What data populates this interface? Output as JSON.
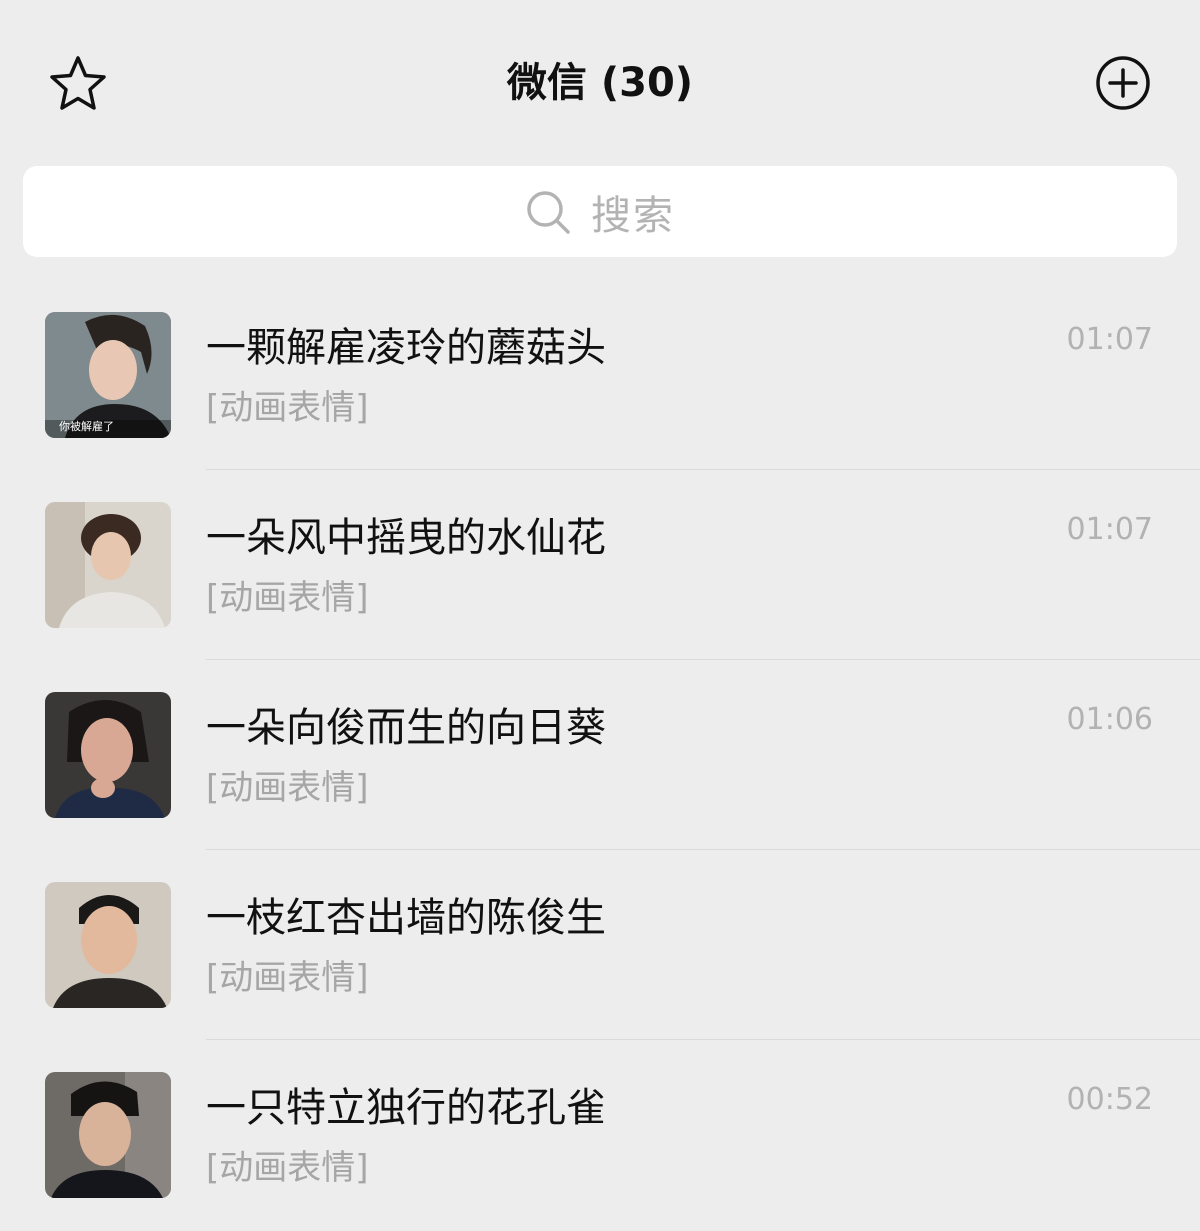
{
  "header": {
    "title": "微信 (30)",
    "left_icon": "star-icon",
    "right_icon": "add-circle-icon"
  },
  "search": {
    "icon": "search-icon",
    "placeholder": "搜索"
  },
  "chats": [
    {
      "name": "一颗解雇凌玲的蘑菇头",
      "preview": "[动画表情]",
      "time": "01:07",
      "avatar_caption": "你被解雇了"
    },
    {
      "name": "一朵风中摇曳的水仙花",
      "preview": "[动画表情]",
      "time": "01:07"
    },
    {
      "name": "一朵向俊而生的向日葵",
      "preview": "[动画表情]",
      "time": "01:06"
    },
    {
      "name": "一枝红杏出墙的陈俊生",
      "preview": "[动画表情]",
      "time": ""
    },
    {
      "name": "一只特立独行的花孔雀",
      "preview": "[动画表情]",
      "time": "00:52"
    }
  ],
  "colors": {
    "background": "#ededed",
    "search_bg": "#ffffff",
    "secondary_text": "#a6a6a6"
  }
}
